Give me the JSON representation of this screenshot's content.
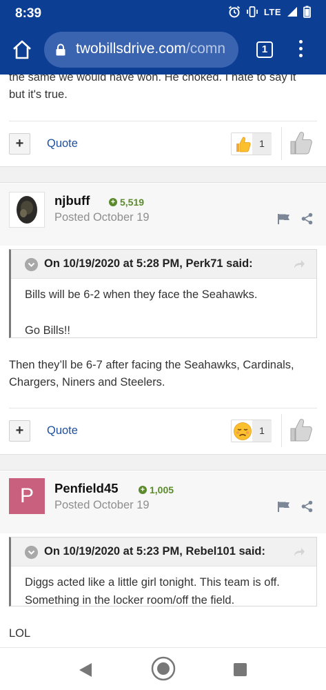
{
  "status_bar": {
    "time": "8:39",
    "network": "LTE",
    "icons": [
      "alarm-icon",
      "vibrate-icon",
      "signal-icon",
      "battery-icon"
    ]
  },
  "browser": {
    "url_host": "twobillsdrive.com",
    "url_rest": "/comn",
    "tab_count": "1",
    "colors": {
      "toolbar": "#0c3f94",
      "url_pill": "#3a64b0"
    }
  },
  "prev_post": {
    "text_line1": "the same we would have won. He choked. I hate to say it",
    "text_line2": "but it's true.",
    "quote_label": "Quote",
    "reaction_count": "1",
    "reaction_icon": "thumbs-up-emoji"
  },
  "posts": [
    {
      "author": "njbuff",
      "reputation": "5,519",
      "posted": "Posted October 19",
      "quote": {
        "header": "On 10/19/2020 at 5:28 PM, Perk71 said:",
        "line1": "Bills will be 6-2 when they face the Seahawks.",
        "line2": "Go Bills!!"
      },
      "text_line1": "Then they’ll be 6-7 after facing the Seahawks, Cardinals,",
      "text_line2": "Chargers, Niners and Steelers.",
      "quote_label": "Quote",
      "reaction_count": "1",
      "reaction_icon": "sad-face-emoji"
    },
    {
      "author": "Penfield45",
      "avatar_letter": "P",
      "reputation": "1,005",
      "posted": "Posted October 19",
      "quote": {
        "header": "On 10/19/2020 at 5:23 PM, Rebel101 said:",
        "line1": "Diggs acted like a little girl tonight. This team is off.",
        "line2": "Something in the locker room/off the field."
      },
      "text_line1": "LOL"
    }
  ],
  "colors": {
    "link": "#1e50a2",
    "reputation": "#5b8a2d",
    "avatar_p": "#c8607e"
  }
}
